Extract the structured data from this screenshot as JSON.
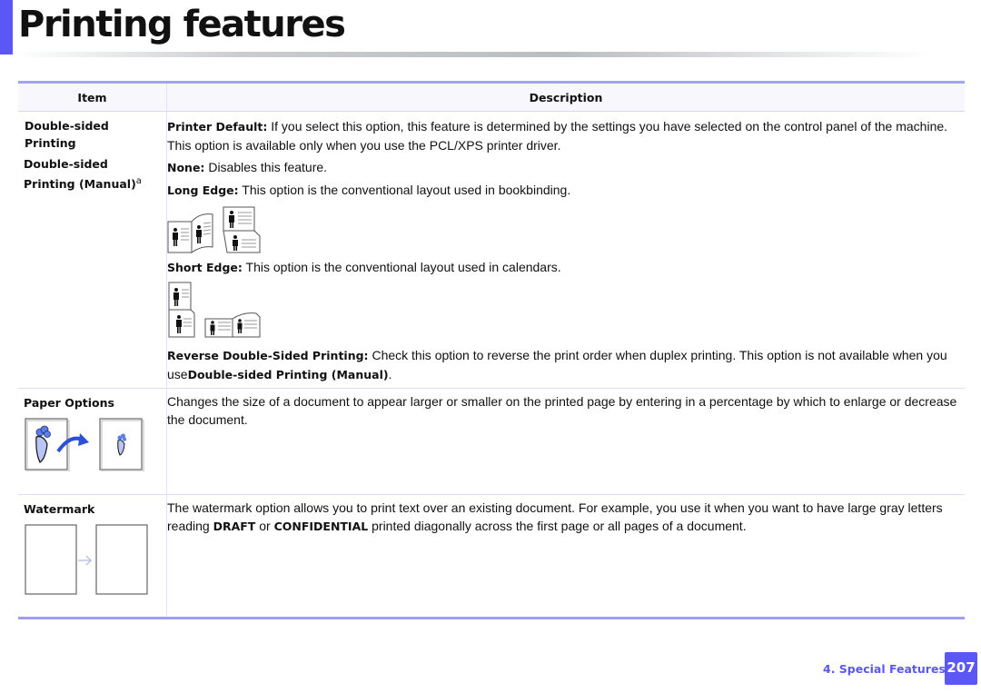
{
  "header": {
    "title": "Printing features"
  },
  "table": {
    "headers": {
      "item": "Item",
      "description": "Description"
    },
    "rows": {
      "duplex": {
        "items": [
          "Double-sided",
          "Printing",
          "Double-sided",
          "Printing (Manual)"
        ],
        "footnote_mark": "a",
        "entries": {
          "printer_default": {
            "label": "Printer Default:",
            "text": " If you select this option, this feature is determined by the settings you have selected on the control panel of the machine.",
            "text2": "This option is available only when you use the PCL/XPS printer driver."
          },
          "none": {
            "label": "None:",
            "text": " Disables this feature."
          },
          "long_edge": {
            "label": "Long Edge:",
            "text": " This option is the conventional layout used in bookbinding.",
            "figure": "long-edge-binding-illustration"
          },
          "short_edge": {
            "label": "Short Edge:",
            "text": " This option is the conventional layout used in calendars.",
            "figure": "short-edge-binding-illustration"
          },
          "reverse": {
            "label": "Reverse Double-Sided Printing:",
            "text": " Check this option to reverse the print order when duplex printing. This option is not available when you use",
            "ref": "Double-sided Printing (Manual)",
            "end": "."
          }
        }
      },
      "paper_options": {
        "item": "Paper Options",
        "description": "Changes the size of a document to appear larger or smaller on the printed page by entering in a percentage by which to enlarge or decrease the document.",
        "figure": "scale-document-illustration"
      },
      "watermark": {
        "item": "Watermark",
        "text1": "The watermark option allows you to print text over an existing document. For example, you use it when you want to have large gray letters reading ",
        "word1": "DRAFT",
        "or": " or ",
        "word2": "CONFIDENTIAL",
        "text2": " printed diagonally across the first page or all pages of a document.",
        "figure": "watermark-illustration"
      }
    }
  },
  "footer": {
    "section": "4.  Special Features",
    "page": "207"
  },
  "colors": {
    "accent": "#5a57f5",
    "table_rule": "#a2a3f3"
  }
}
